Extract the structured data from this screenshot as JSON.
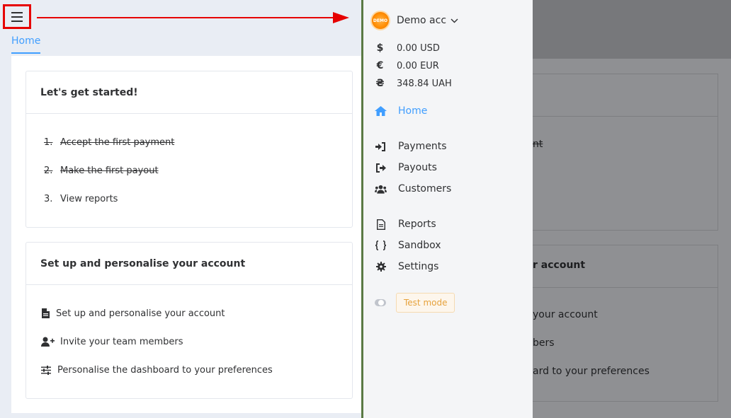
{
  "header": {
    "tab": "Home"
  },
  "getting_started": {
    "title": "Let's get started!",
    "steps": [
      {
        "num": "1.",
        "text": "Accept the first payment",
        "done": true
      },
      {
        "num": "2.",
        "text": "Make the first payout",
        "done": true
      },
      {
        "num": "3.",
        "text": "View reports",
        "done": false
      }
    ]
  },
  "setup": {
    "title": "Set up and personalise your account",
    "items": [
      {
        "icon": "file-icon",
        "text": "Set up and personalise your account"
      },
      {
        "icon": "user-plus-icon",
        "text": "Invite your team members"
      },
      {
        "icon": "sliders-icon",
        "text": "Personalise the dashboard to your preferences"
      }
    ]
  },
  "sidebar": {
    "avatar_text": "DEMO",
    "account_name": "Demo acc",
    "balances": [
      {
        "symbol": "$",
        "amount": "0.00 USD"
      },
      {
        "symbol": "€",
        "amount": "0.00 EUR"
      },
      {
        "symbol": "₴",
        "amount": "348.84 UAH"
      }
    ],
    "nav": [
      {
        "label": "Home",
        "icon": "home-icon",
        "active": true
      },
      {
        "label": "Payments",
        "icon": "sign-in-icon"
      },
      {
        "label": "Payouts",
        "icon": "sign-out-icon"
      },
      {
        "label": "Customers",
        "icon": "users-icon"
      },
      {
        "label": "Reports",
        "icon": "file-text-icon"
      },
      {
        "label": "Sandbox",
        "icon": "braces-icon"
      },
      {
        "label": "Settings",
        "icon": "gear-icon"
      }
    ],
    "test_mode_label": "Test mode"
  },
  "overlay": {
    "fragments": [
      "nt",
      "r account",
      "your account",
      "bers",
      "ard to your preferences"
    ]
  },
  "colors": {
    "accent": "#409eff",
    "highlight": "#e60000",
    "warning": "#e6a23c"
  }
}
